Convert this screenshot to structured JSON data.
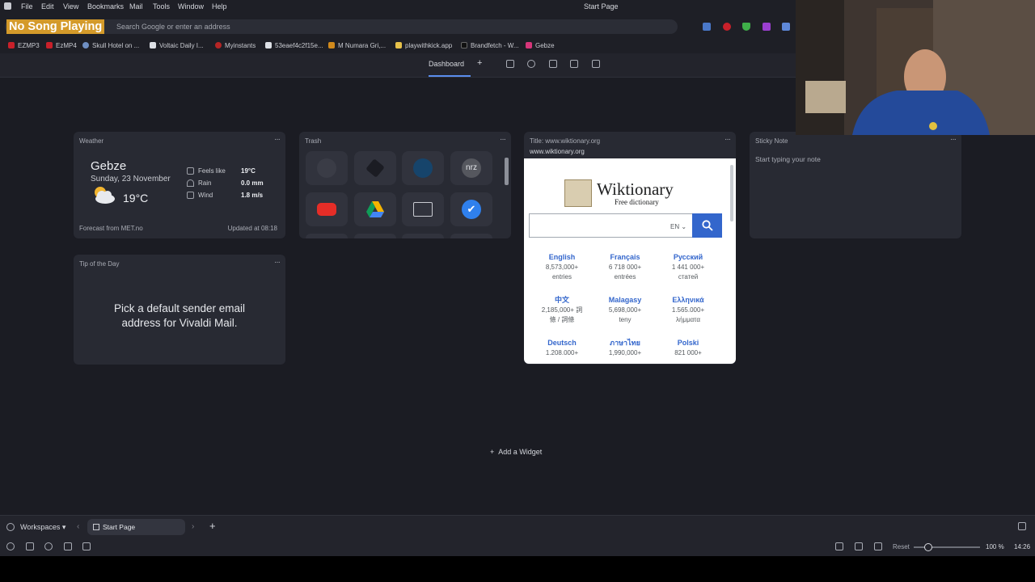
{
  "menu": [
    "File",
    "Edit",
    "View",
    "Bookmarks",
    "Mail",
    "Tools",
    "Window",
    "Help"
  ],
  "window_title": "Start Page",
  "overlay": "No Song Playing",
  "address": {
    "placeholder": "Search Google or enter an address"
  },
  "bookmarks": [
    "EZMP3",
    "EzMP4",
    "Skull Hotel on ...",
    "Voltaic Daily I...",
    "Myinstants",
    "53eaef4c2f15e...",
    "M Numara Gri,...",
    "playwithkick.app",
    "Brandfetch - W...",
    "Gebze"
  ],
  "dashboard": {
    "tab": "Dashboard",
    "add": "+"
  },
  "weather": {
    "title": "Weather",
    "city": "Gebze",
    "date": "Sunday, 23 November",
    "temp": "19°C",
    "feels_label": "Feels like",
    "feels": "19°C",
    "rain_label": "Rain",
    "rain": "0.0 mm",
    "wind_label": "Wind",
    "wind": "1.8 m/s",
    "forecast": "Forecast from MET.no",
    "updated": "Updated at 08:18"
  },
  "trash": {
    "title": "Trash",
    "tiles": [
      "github-icon",
      "brush-icon",
      "steam-icon",
      "nrz-icon",
      "youtube-icon",
      "drive-icon",
      "folder-icon",
      "check-icon"
    ],
    "nrz_text": "nrz"
  },
  "wiktionary": {
    "title": "Title: www.wiktionary.org",
    "url": "www.wiktionary.org",
    "name": "Wiktionary",
    "subtitle": "Free dictionary",
    "lang_selector": "EN",
    "languages": [
      {
        "name": "English",
        "l1": "8,573,000+",
        "l2": "entries"
      },
      {
        "name": "Français",
        "l1": "6 718 000+",
        "l2": "entrées"
      },
      {
        "name": "Русский",
        "l1": "1 441 000+",
        "l2": "статей"
      },
      {
        "name": "中文",
        "l1": "2,185,000+ 詞",
        "l2": "條 / 詞條"
      },
      {
        "name": "Malagasy",
        "l1": "5,698,000+",
        "l2": "teny"
      },
      {
        "name": "Ελληνικά",
        "l1": "1.565.000+",
        "l2": "λήμματα"
      },
      {
        "name": "Deutsch",
        "l1": "1.208.000+",
        "l2": ""
      },
      {
        "name": "ภาษาไทย",
        "l1": "1,990,000+",
        "l2": ""
      },
      {
        "name": "Polski",
        "l1": "821 000+",
        "l2": ""
      }
    ]
  },
  "sticky": {
    "title": "Sticky Note",
    "placeholder": "Start typing your note"
  },
  "tip": {
    "title": "Tip of the Day",
    "line1": "Pick a default sender email",
    "line2": "address for Vivaldi Mail."
  },
  "add_widget": "Add a Widget",
  "tabbar": {
    "workspaces": "Workspaces",
    "tab": "Start Page",
    "new_tab": "+"
  },
  "status": {
    "reset": "Reset",
    "zoom": "100 %",
    "time": "14:26"
  },
  "colors": {
    "accent": "#5a8dee",
    "overlay": "#d49a2a",
    "wiki_blue": "#3366cc"
  }
}
